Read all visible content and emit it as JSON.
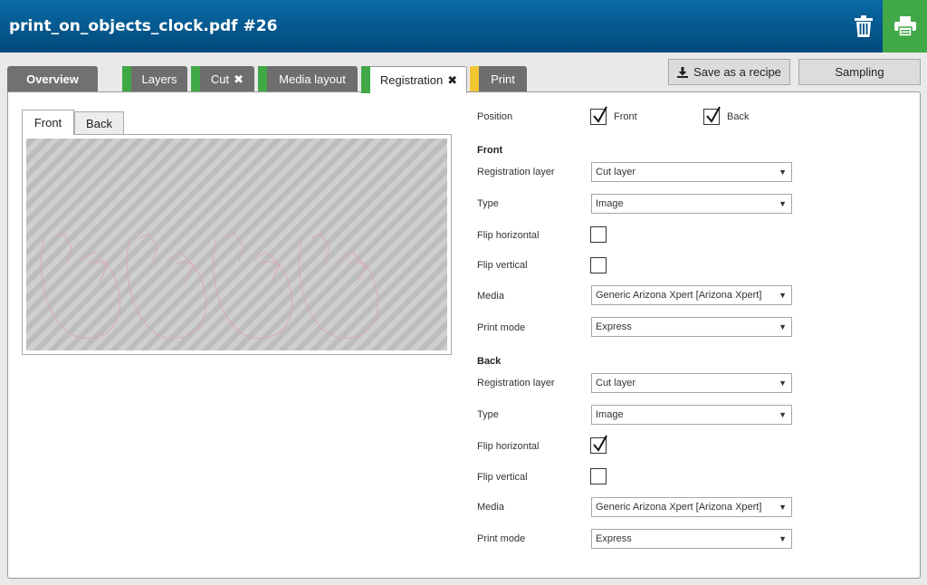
{
  "header": {
    "title": "print_on_objects_clock.pdf #26"
  },
  "tabs": [
    {
      "label": "Overview"
    },
    {
      "label": "Layers"
    },
    {
      "label": "Cut"
    },
    {
      "label": "Media layout"
    },
    {
      "label": "Registration"
    },
    {
      "label": "Print"
    }
  ],
  "actions": {
    "save_recipe": "Save as a recipe",
    "sampling": "Sampling"
  },
  "preview": {
    "front_tab": "Front",
    "back_tab": "Back"
  },
  "form": {
    "position_label": "Position",
    "position_front": "Front",
    "position_back": "Back",
    "front": {
      "heading": "Front",
      "reg_layer_label": "Registration layer",
      "reg_layer_value": "Cut layer",
      "type_label": "Type",
      "type_value": "Image",
      "flip_h_label": "Flip horizontal",
      "flip_v_label": "Flip vertical",
      "media_label": "Media",
      "media_value": "Generic Arizona Xpert [Arizona Xpert]",
      "print_mode_label": "Print mode",
      "print_mode_value": "Express"
    },
    "back": {
      "heading": "Back",
      "reg_layer_label": "Registration layer",
      "reg_layer_value": "Cut layer",
      "type_label": "Type",
      "type_value": "Image",
      "flip_h_label": "Flip horizontal",
      "flip_v_label": "Flip vertical",
      "media_label": "Media",
      "media_value": "Generic Arizona Xpert [Arizona Xpert]",
      "print_mode_label": "Print mode",
      "print_mode_value": "Express"
    }
  },
  "state": {
    "position_front_checked": true,
    "position_back_checked": true,
    "front_flip_h": false,
    "front_flip_v": false,
    "back_flip_h": true,
    "back_flip_v": false
  },
  "colors": {
    "header_top": "#0a6aa6",
    "header_bottom": "#01497a",
    "print_button": "#41a847",
    "tab_green": "#41a847",
    "tab_yellow": "#f2c633",
    "tab_gray": "#6e6e6e"
  },
  "icons": {
    "trash": "trash-icon",
    "print": "printer-icon",
    "download": "download-icon",
    "close": "close-icon",
    "dropdown": "chevron-down-icon",
    "check": "check-icon"
  }
}
